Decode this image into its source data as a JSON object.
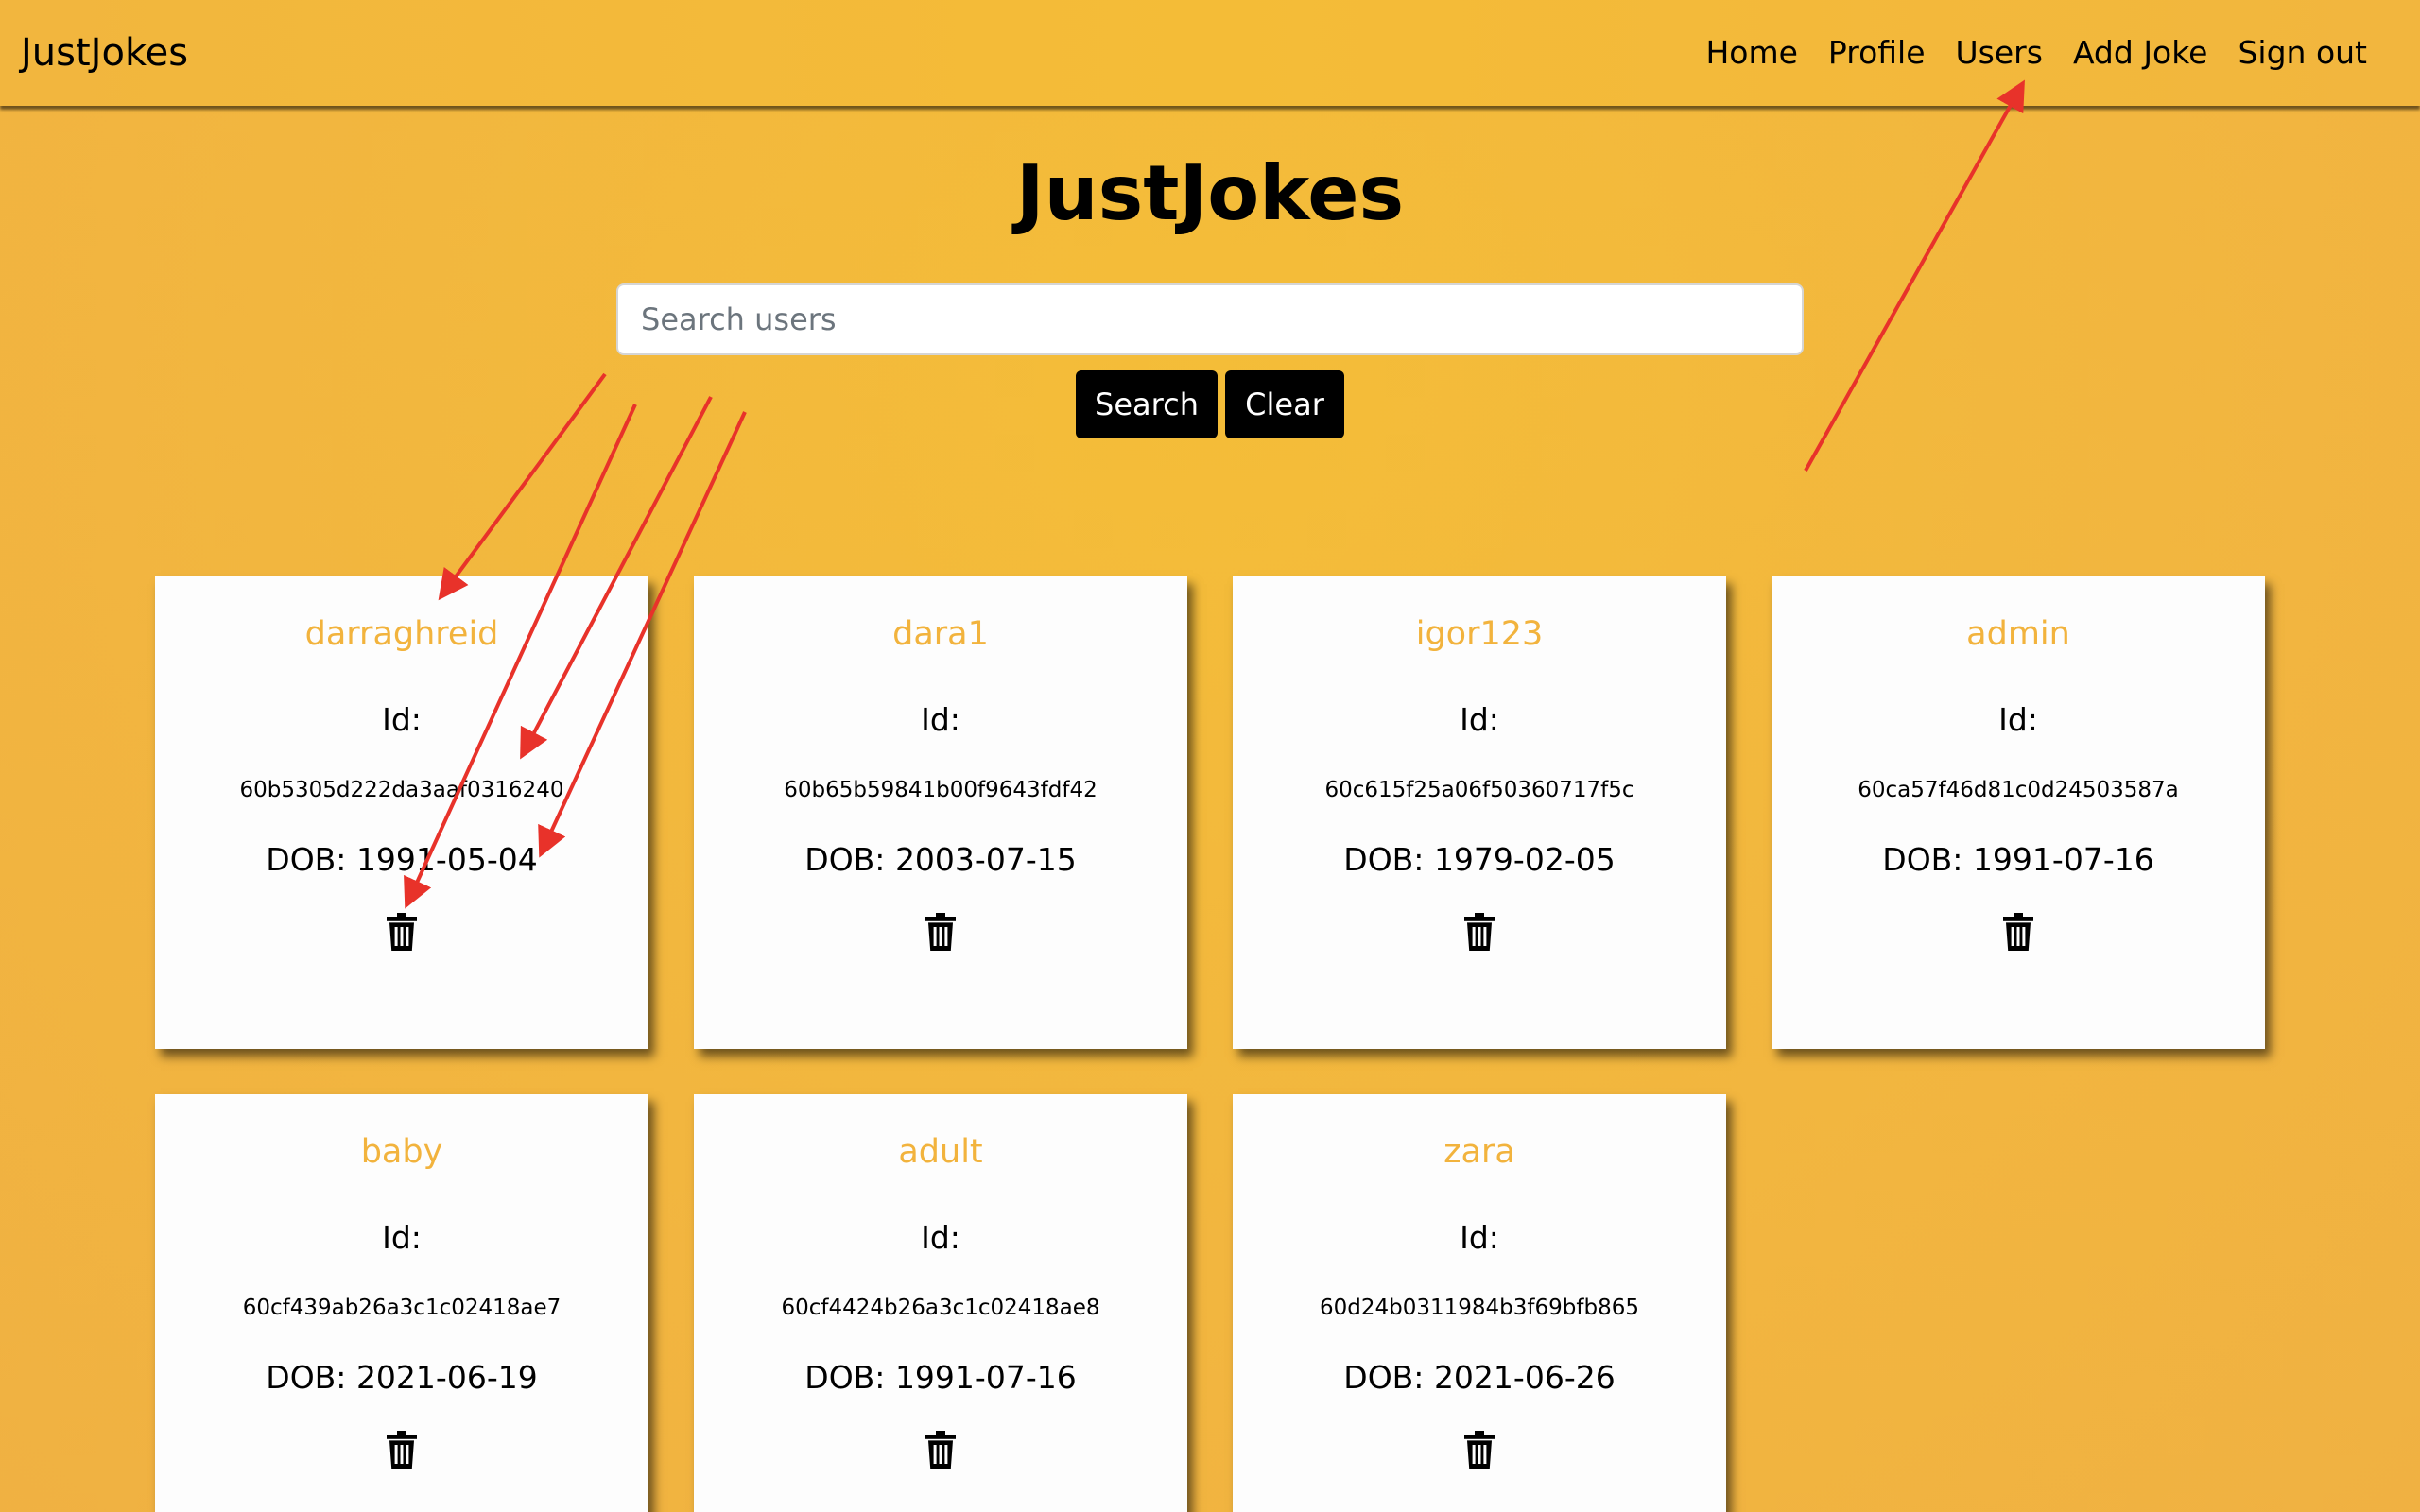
{
  "nav": {
    "brand": "JustJokes",
    "links": [
      "Home",
      "Profile",
      "Users",
      "Add Joke",
      "Sign out"
    ]
  },
  "page": {
    "title": "JustJokes"
  },
  "search": {
    "placeholder": "Search users",
    "value": "",
    "search_label": "Search",
    "clear_label": "Clear"
  },
  "users": [
    {
      "username": "darraghreid",
      "id_label": "Id:",
      "id": "60b5305d222da3aaf0316240",
      "dob_label": "DOB:",
      "dob": "1991-05-04"
    },
    {
      "username": "dara1",
      "id_label": "Id:",
      "id": "60b65b59841b00f9643fdf42",
      "dob_label": "DOB:",
      "dob": "2003-07-15"
    },
    {
      "username": "igor123",
      "id_label": "Id:",
      "id": "60c615f25a06f50360717f5c",
      "dob_label": "DOB:",
      "dob": "1979-02-05"
    },
    {
      "username": "admin",
      "id_label": "Id:",
      "id": "60ca57f46d81c0d24503587a",
      "dob_label": "DOB:",
      "dob": "1991-07-16"
    },
    {
      "username": "baby",
      "id_label": "Id:",
      "id": "60cf439ab26a3c1c02418ae7",
      "dob_label": "DOB:",
      "dob": "2021-06-19"
    },
    {
      "username": "adult",
      "id_label": "Id:",
      "id": "60cf4424b26a3c1c02418ae8",
      "dob_label": "DOB:",
      "dob": "1991-07-16"
    },
    {
      "username": "zara",
      "id_label": "Id:",
      "id": "60d24b0311984b3f69bfb865",
      "dob_label": "DOB:",
      "dob": "2021-06-26"
    }
  ],
  "icons": {
    "delete": "trash-icon"
  },
  "colors": {
    "background": "#f2b63e",
    "username": "#f2b33d",
    "button": "#000000",
    "annotation_arrow": "#e8322a"
  }
}
